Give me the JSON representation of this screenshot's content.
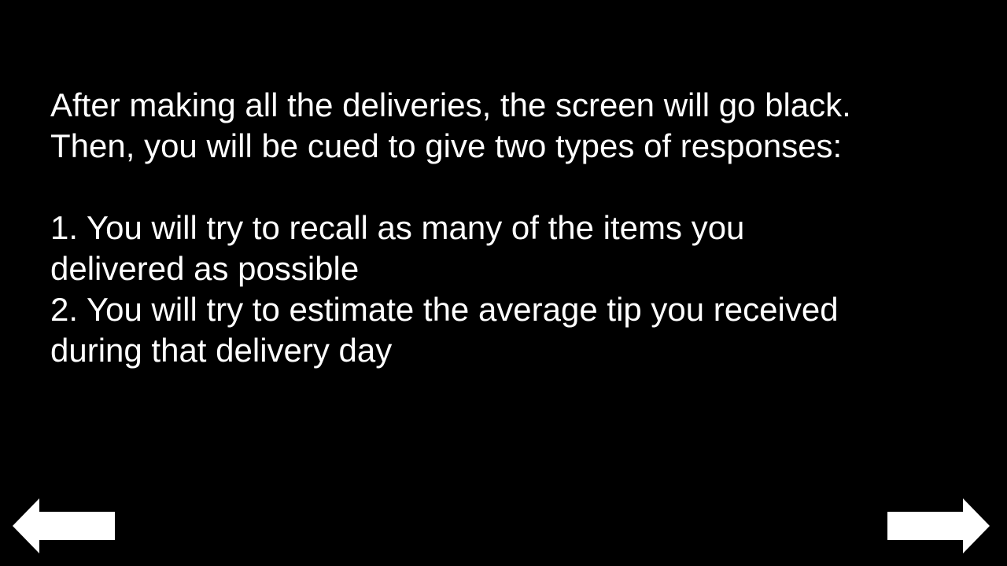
{
  "slide": {
    "paragraph_1": [
      "After making all the deliveries, the screen will go black.",
      "Then, you will be cued to give two types of responses:"
    ],
    "item_1": [
      "1. You will try to recall as many of the items you",
      "delivered as possible"
    ],
    "item_2": [
      "2. You will try to estimate the average tip you received",
      "during that delivery day"
    ]
  },
  "navigation": {
    "back_icon": "left-arrow-icon",
    "next_icon": "right-arrow-icon"
  },
  "colors": {
    "background": "#000000",
    "text": "#ffffff",
    "arrow_fill": "#ffffff"
  }
}
